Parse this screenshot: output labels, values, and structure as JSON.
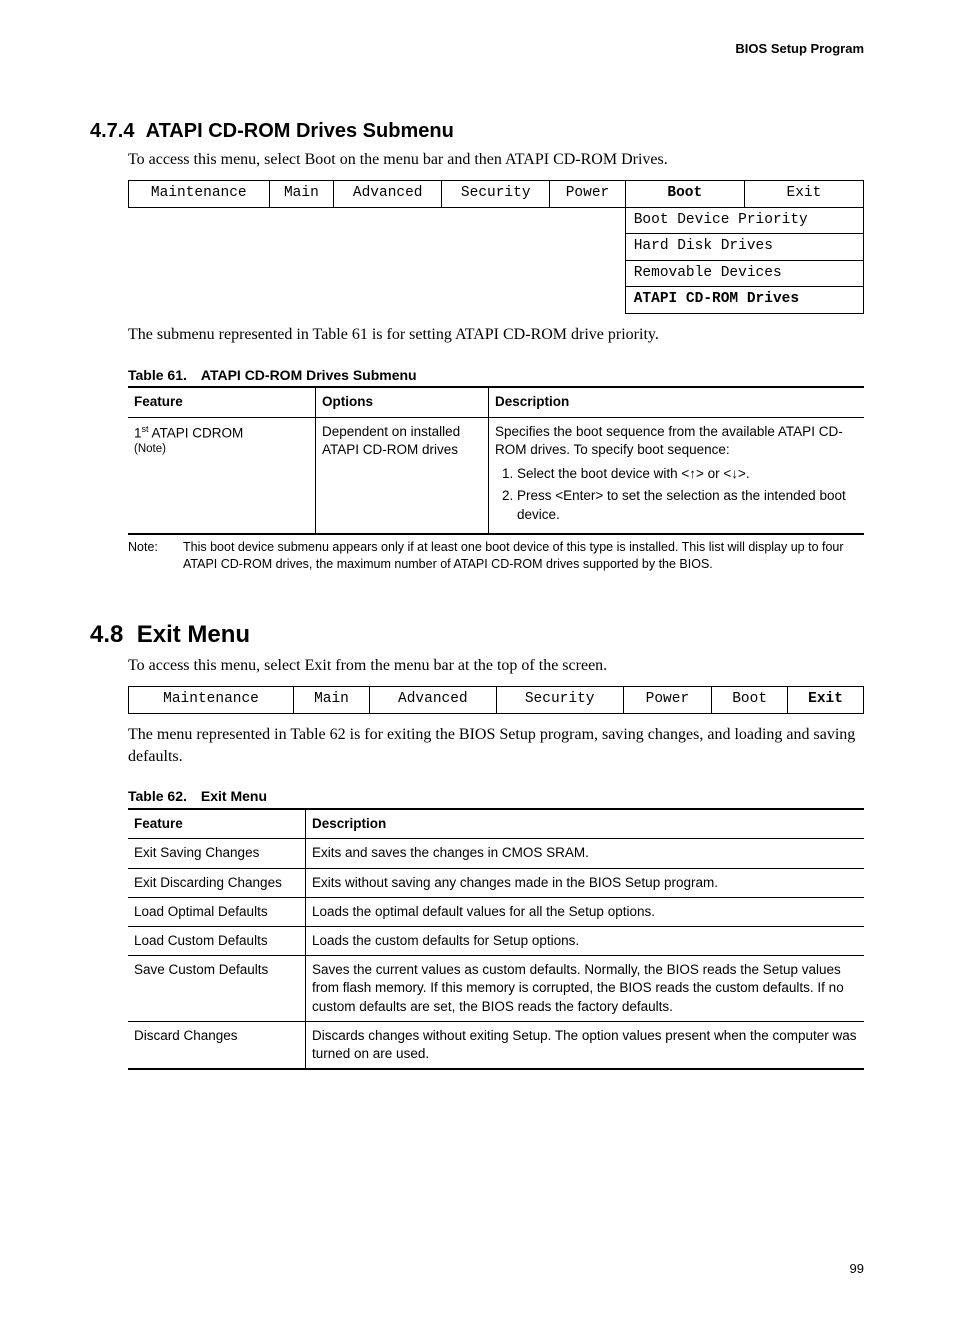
{
  "header": "BIOS Setup Program",
  "sec474": {
    "num": "4.7.4",
    "title": "ATAPI CD-ROM Drives Submenu",
    "intro": "To access this menu, select Boot on the menu bar and then ATAPI CD-ROM Drives.",
    "menu": {
      "tabs": [
        "Maintenance",
        "Main",
        "Advanced",
        "Security",
        "Power",
        "Boot",
        "Exit"
      ],
      "active": "Boot",
      "dropdown": [
        "Boot Device Priority",
        "Hard Disk Drives",
        "Removable Devices",
        "ATAPI CD-ROM Drives"
      ],
      "ddActive": "ATAPI CD-ROM Drives"
    },
    "caption_sentence": "The submenu represented in Table 61 is for setting ATAPI CD-ROM drive priority.",
    "table_caption": "Table 61. ATAPI CD-ROM Drives Submenu",
    "table": {
      "headers": [
        "Feature",
        "Options",
        "Description"
      ],
      "row": {
        "feature_main": "1",
        "feature_sup": "st",
        "feature_rest": " ATAPI CDROM",
        "feature_note": "(Note)",
        "options": "Dependent on installed ATAPI CD-ROM drives",
        "desc_line": "Specifies the boot sequence from the available ATAPI CD-ROM drives.  To specify boot sequence:",
        "steps": [
          "Select the boot device with <↑> or <↓>.",
          "Press <Enter> to set the selection as the intended boot device."
        ]
      }
    },
    "note_label": "Note:",
    "note_text": "This boot device submenu appears only if at least one boot device of this type is installed.  This list will display up to four ATAPI CD-ROM drives, the maximum number of ATAPI CD-ROM drives supported by the BIOS."
  },
  "sec48": {
    "num": "4.8",
    "title": "Exit Menu",
    "intro": "To access this menu, select Exit from the menu bar at the top of the screen.",
    "menu": {
      "tabs": [
        "Maintenance",
        "Main",
        "Advanced",
        "Security",
        "Power",
        "Boot",
        "Exit"
      ],
      "active": "Exit"
    },
    "caption_sentence": "The menu represented in Table 62 is for exiting the BIOS Setup program, saving changes, and loading and saving defaults.",
    "table_caption": "Table 62. Exit Menu",
    "table": {
      "headers": [
        "Feature",
        "Description"
      ],
      "rows": [
        {
          "feature": "Exit Saving Changes",
          "desc": "Exits and saves the changes in CMOS SRAM."
        },
        {
          "feature": "Exit Discarding Changes",
          "desc": "Exits without saving any changes made in the BIOS Setup program."
        },
        {
          "feature": "Load Optimal Defaults",
          "desc": "Loads the optimal default values for all the Setup options."
        },
        {
          "feature": "Load Custom Defaults",
          "desc": "Loads the custom defaults for Setup options."
        },
        {
          "feature": "Save Custom Defaults",
          "desc": "Saves the current values as custom defaults.  Normally, the BIOS reads the Setup values from flash memory.  If this memory is corrupted, the BIOS reads the custom defaults.  If no custom defaults are set, the BIOS reads the factory defaults."
        },
        {
          "feature": "Discard Changes",
          "desc": "Discards changes without exiting Setup.  The option values present when the computer was turned on are used."
        }
      ]
    }
  },
  "page_number": "99"
}
